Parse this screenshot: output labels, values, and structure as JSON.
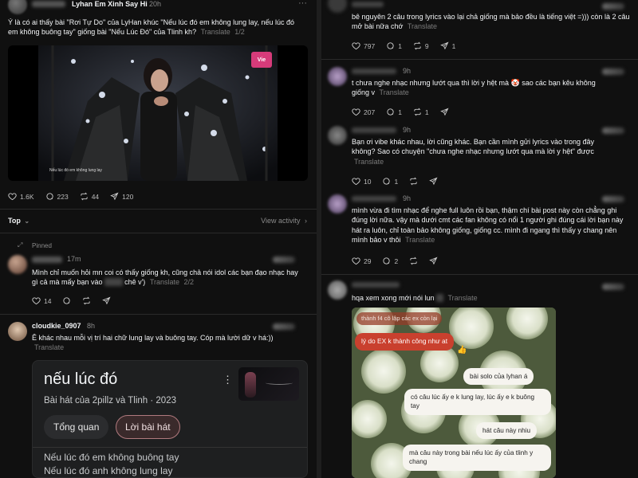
{
  "left": {
    "post": {
      "username": "Lyhan Em Xinh Say Hi",
      "time": "20h",
      "text": "Ý là có ai thấy bài \"Rơi Tự Do\" của LyHan khúc \"Nếu lúc đó em không lung lay, nếu lúc đó em không buông tay\" giống bài \"Nếu Lúc Đó\" của Tlinh kh?",
      "translate": "Translate",
      "page": "1/2",
      "video_caption": "Nếu lúc đó em không lung lay",
      "channel_logo": "Vie CHANNEL",
      "stats": {
        "likes": "1.6K",
        "comments": "223",
        "reposts": "44",
        "shares": "120"
      }
    },
    "top_bar": {
      "sort": "Top",
      "view_activity": "View activity"
    },
    "pinned": {
      "label": "Pinned",
      "time": "17m",
      "text": "Mình chỉ muốn hỏi mn coi có thấy giống kh, cũng chả nói idol các bạn đạo nhạc hay gì cả mà mấy bạn vào",
      "text_tail": "chê v')",
      "translate": "Translate",
      "page": "2/2",
      "stats": {
        "likes": "14"
      }
    },
    "reply": {
      "username": "cloudkie_0907",
      "time": "8h",
      "text": "Ê khác nhau mỗi vị trí hai chữ lung lay và buông tay. Cóp mà lười dữ v há:))",
      "translate": "Translate"
    },
    "song_card": {
      "title": "nếu lúc đó",
      "subtitle": "Bài hát của 2pillz và Tlinh · 2023",
      "tab_overview": "Tổng quan",
      "tab_lyrics": "Lời bài hát",
      "lyric_1": "Nếu lúc đó em không buông tay",
      "lyric_2": "Nếu lúc đó anh không lung lay"
    }
  },
  "right": {
    "c1": {
      "text": "bê nguyên 2 câu trong lyrics vào lại chả giống mà bảo đều là tiếng việt =))) còn là 2 câu mở bài nữa chớ",
      "translate": "Translate",
      "stats": {
        "likes": "797",
        "comments": "1",
        "reposts": "9",
        "shares": "1"
      }
    },
    "c2": {
      "time": "9h",
      "text": "t chưa nghe nhạc nhưng lướt qua thì lời y hệt mà",
      "emoji": "🤡",
      "text_2": "sao các bạn kêu không giống v",
      "translate": "Translate",
      "stats": {
        "likes": "207",
        "comments": "1",
        "reposts": "1"
      }
    },
    "c3": {
      "time": "9h",
      "text": "Bạn ơi vibe khác nhau, lời cũng khác. Bạn cần mình gửi lyrics vào trong đây không? Sao có chuyện \"chưa nghe nhạc nhưng lướt qua mà lời y hệt\" được",
      "translate": "Translate",
      "stats": {
        "likes": "10",
        "comments": "1"
      }
    },
    "c4": {
      "time": "9h",
      "text": "mình vừa đi tìm nhạc để nghe full luôn rồi bạn, thậm chí bài post này còn chẳng ghi đúng lời nữa. vậy mà dưới cmt các fan không có nổi 1 người ghi đúng cái lời bạn này hát ra luôn, chỉ toàn bảo không giống, giống cc. mình đi ngang thì thấy y chang nên mình bảo v thôi",
      "translate": "Translate",
      "stats": {
        "likes": "29",
        "comments": "2"
      }
    },
    "c5": {
      "text": "hqa xem xong mới nói lun",
      "translate": "Translate",
      "chat": {
        "m1": "thành f4 cô lập các ex còn lại",
        "m2": "lý do EX k thành công như at",
        "m3": "bài solo của lyhan á",
        "m4": "có câu lúc ấy e k lung lay, lúc ấy e k buông tay",
        "m5": "hát câu này nhiu",
        "m6": "mà câu này trong bài nếu lúc ấy của tlinh y chang"
      }
    }
  },
  "colors": {
    "bg": "#101010",
    "text": "#f3f5f7",
    "muted": "#8a8a8a",
    "card": "#1e1f20",
    "tab_active": "#3a2a2b"
  }
}
